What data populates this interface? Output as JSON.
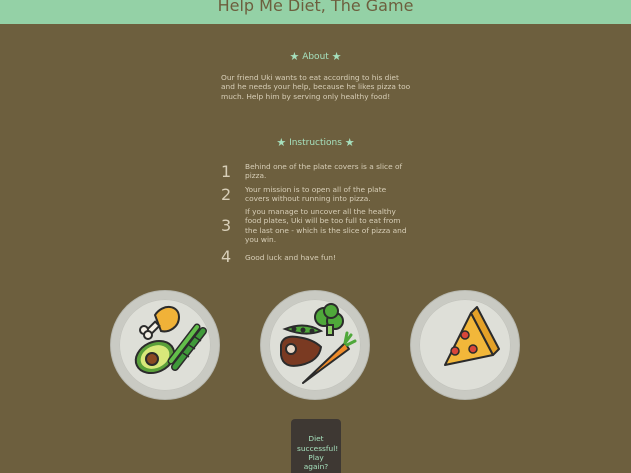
{
  "header": {
    "title": "Help Me Diet, The Game"
  },
  "about": {
    "title": "About",
    "text": "Our friend Uki wants to eat according to his diet and he needs your help, because he likes pizza too much. Help him by serving only healthy food!"
  },
  "instructions": {
    "title": "Instructions",
    "steps": [
      {
        "num": "1",
        "text": "Behind one of the plate covers is a slice of pizza."
      },
      {
        "num": "2",
        "text": "Your mission is to open all of the plate covers without running into pizza."
      },
      {
        "num": "3",
        "text": "If you manage to uncover all the healthy food plates, Uki will be too full to eat from the last one - which is the slice of pizza and you win."
      },
      {
        "num": "4",
        "text": "Good luck and have fun!"
      }
    ]
  },
  "plates": [
    {
      "contents": "chicken-leg, avocado, asparagus"
    },
    {
      "contents": "steak, peas, broccoli, carrot"
    },
    {
      "contents": "pizza-slice"
    }
  ],
  "result_button": {
    "label": "Diet successful! Play again?"
  },
  "colors": {
    "header": "#94d1a6",
    "background": "#6d5f3e",
    "accent": "#a6e0bd",
    "button": "#3e3833"
  }
}
